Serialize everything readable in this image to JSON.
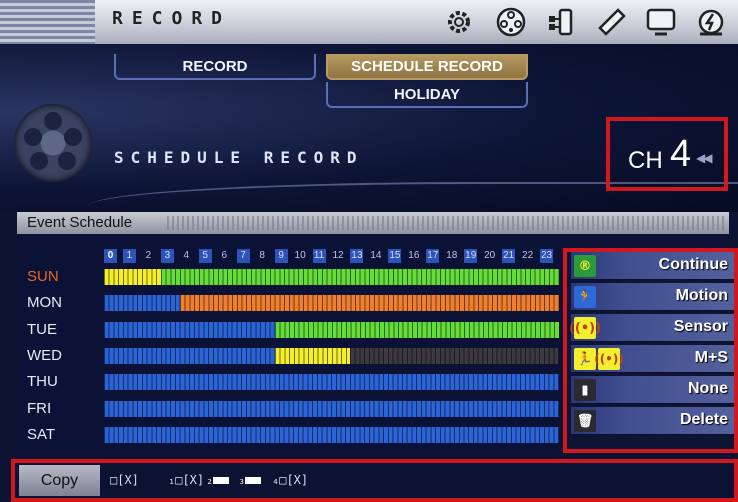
{
  "app": {
    "title": "RECORD"
  },
  "toolbar_icons": [
    "gear-icon",
    "film-reel-icon",
    "network-icon",
    "usb-icon",
    "monitor-icon",
    "power-icon"
  ],
  "tabs": [
    {
      "label": "RECORD",
      "active": false
    },
    {
      "label": "SCHEDULE RECORD",
      "active": true
    },
    {
      "label": "HOLIDAY",
      "active": false
    }
  ],
  "section_title": "SCHEDULE RECORD",
  "channel": {
    "label": "CH",
    "number": "4"
  },
  "panel_title": "Event Schedule",
  "hours": [
    "0",
    "1",
    "2",
    "3",
    "4",
    "5",
    "6",
    "7",
    "8",
    "9",
    "10",
    "11",
    "12",
    "13",
    "14",
    "15",
    "16",
    "17",
    "18",
    "19",
    "20",
    "21",
    "22",
    "23"
  ],
  "colors": {
    "continue": "#f4ee2e",
    "motion": "#ef7f2f",
    "sensor": "#f4ee2e",
    "ms": "#f4ee2e",
    "none": "#3a3a40",
    "green": "#64dc3a",
    "blue": "#2b64d6"
  },
  "days": [
    {
      "label": "SUN",
      "segments": [
        {
          "from": 0,
          "to": 3,
          "mode": "continue"
        },
        {
          "from": 3,
          "to": 24,
          "mode": "green"
        }
      ]
    },
    {
      "label": "MON",
      "segments": [
        {
          "from": 0,
          "to": 4,
          "mode": "blue"
        },
        {
          "from": 4,
          "to": 24,
          "mode": "motion"
        }
      ]
    },
    {
      "label": "TUE",
      "segments": [
        {
          "from": 0,
          "to": 9,
          "mode": "blue"
        },
        {
          "from": 9,
          "to": 24,
          "mode": "green"
        }
      ]
    },
    {
      "label": "WED",
      "segments": [
        {
          "from": 0,
          "to": 9,
          "mode": "blue"
        },
        {
          "from": 9,
          "to": 13,
          "mode": "continue"
        },
        {
          "from": 13,
          "to": 24,
          "mode": "none"
        }
      ]
    },
    {
      "label": "THU",
      "segments": [
        {
          "from": 0,
          "to": 24,
          "mode": "blue"
        }
      ]
    },
    {
      "label": "FRI",
      "segments": [
        {
          "from": 0,
          "to": 24,
          "mode": "blue"
        }
      ]
    },
    {
      "label": "SAT",
      "segments": [
        {
          "from": 0,
          "to": 24,
          "mode": "blue"
        }
      ]
    }
  ],
  "modes": [
    {
      "label": "Continue",
      "icon": "continue-icon"
    },
    {
      "label": "Motion",
      "icon": "motion-icon"
    },
    {
      "label": "Sensor",
      "icon": "sensor-icon"
    },
    {
      "label": "M+S",
      "icon": "motion-sensor-icon"
    },
    {
      "label": "None",
      "icon": "none-icon"
    },
    {
      "label": "Delete",
      "icon": "trash-icon"
    }
  ],
  "copy": {
    "label": "Copy",
    "items": [
      "□[X]",
      "₁□[X]",
      "₂",
      "₃",
      "₄□[X]"
    ]
  }
}
